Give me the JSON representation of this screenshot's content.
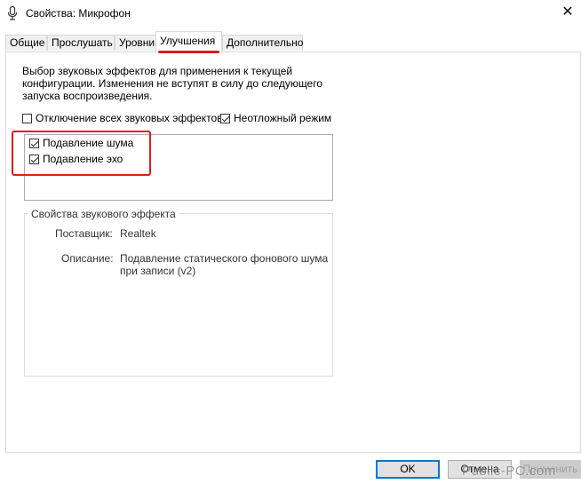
{
  "window": {
    "title": "Свойства: Микрофон",
    "close_glyph": "✕",
    "icon": "microphone-icon"
  },
  "tabs": [
    {
      "label": "Общие",
      "active": false
    },
    {
      "label": "Прослушать",
      "active": false
    },
    {
      "label": "Уровни",
      "active": false
    },
    {
      "label": "Улучшения",
      "active": true
    },
    {
      "label": "Дополнительно",
      "active": false
    }
  ],
  "enhancements": {
    "description_lines": [
      "Выбор звуковых эффектов для применения к текущей",
      "конфигурации. Изменения не вступят в силу до следующего",
      "запуска воспроизведения."
    ],
    "disable_all": {
      "label": "Отключение всех звуковых эффектов",
      "checked": false
    },
    "immediate_mode": {
      "label": "Неотложный режим",
      "checked": true
    },
    "effects": [
      {
        "label": "Подавление шума",
        "checked": true
      },
      {
        "label": "Подавление эхо",
        "checked": true
      }
    ],
    "highlight_color": "#e21b1b"
  },
  "properties": {
    "group_title": "Свойства звукового эффекта",
    "provider_label": "Поставщик:",
    "provider_value": "Realtek",
    "description_label": "Описание:",
    "description_lines": [
      "Подавление статического фонового шума",
      "при записи (v2)"
    ]
  },
  "buttons": {
    "ok": "OK",
    "cancel": "Отмена",
    "apply": "Применить"
  },
  "watermark": "Public-PC.com"
}
